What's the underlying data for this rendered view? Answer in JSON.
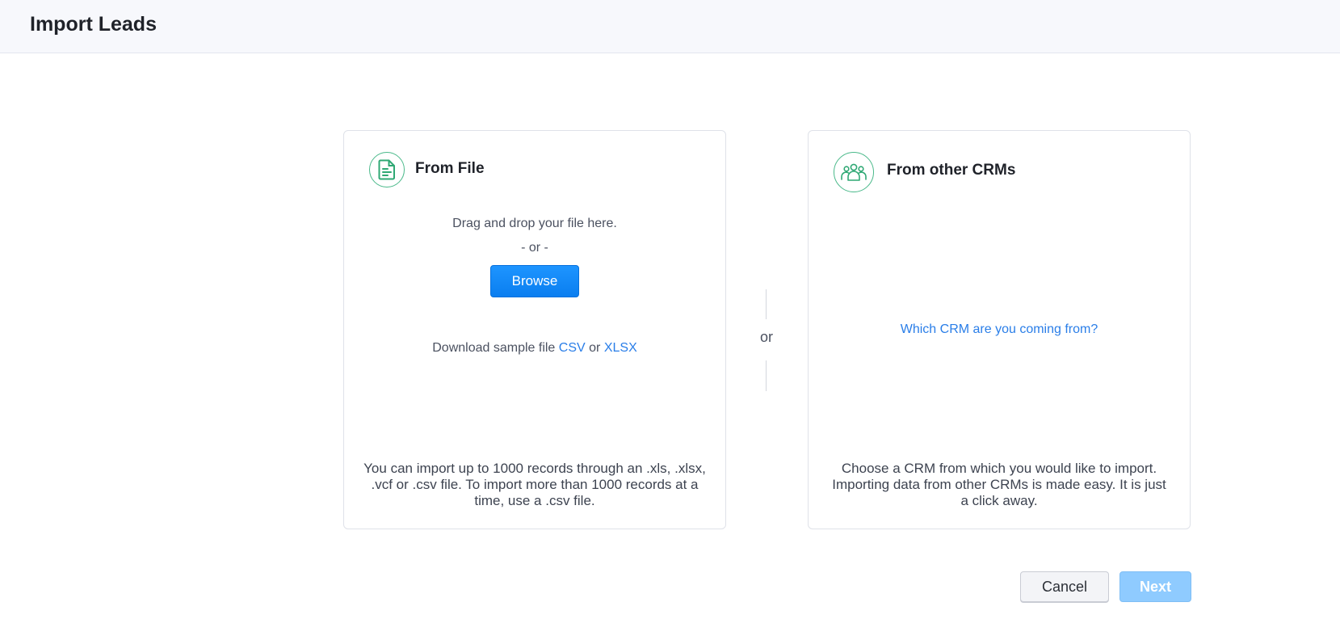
{
  "page": {
    "title": "Import Leads"
  },
  "from_file": {
    "title": "From File",
    "icon": "file-icon",
    "drag_text": "Drag and drop your file here.",
    "or_text": "-  or  -",
    "browse_label": "Browse",
    "download_prefix": "Download sample file",
    "csv_label": "CSV",
    "or_word": "or",
    "xlsx_label": "XLSX",
    "note": "You can import up to 1000 records through an .xls, .xlsx, .vcf or .csv file. To import more than 1000 records at a time, use a .csv file."
  },
  "divider": {
    "or_label": "or"
  },
  "from_crm": {
    "title": "From other CRMs",
    "icon": "users-group-icon",
    "link_label": "Which CRM are you coming from?",
    "note": "Choose a CRM from which you would like to import. Importing data from other CRMs is made easy. It is just a click away."
  },
  "actions": {
    "cancel_label": "Cancel",
    "next_label": "Next"
  },
  "colors": {
    "accent": "#0a7ef0",
    "link": "#2a7ee8",
    "icon_green": "#2fa874",
    "next_disabled": "#8fcbff"
  }
}
